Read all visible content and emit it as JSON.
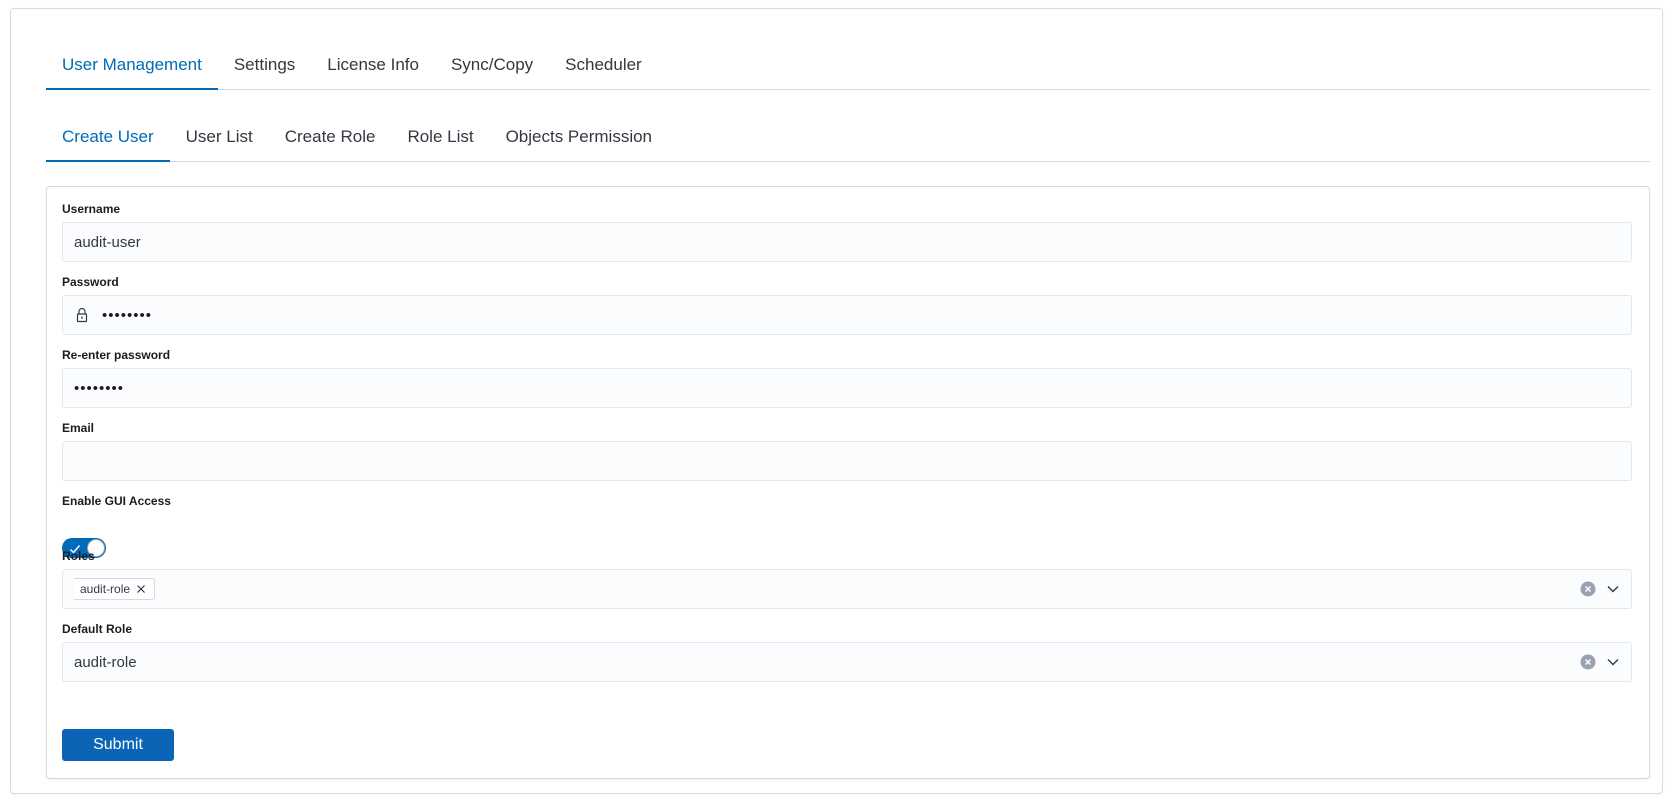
{
  "top_tabs": [
    {
      "label": "User Management",
      "active": true
    },
    {
      "label": "Settings",
      "active": false
    },
    {
      "label": "License Info",
      "active": false
    },
    {
      "label": "Sync/Copy",
      "active": false
    },
    {
      "label": "Scheduler",
      "active": false
    }
  ],
  "sub_tabs": [
    {
      "label": "Create User",
      "active": true
    },
    {
      "label": "User List",
      "active": false
    },
    {
      "label": "Create Role",
      "active": false
    },
    {
      "label": "Role List",
      "active": false
    },
    {
      "label": "Objects Permission",
      "active": false
    }
  ],
  "form": {
    "username": {
      "label": "Username",
      "value": "audit-user"
    },
    "password": {
      "label": "Password",
      "value": "••••••••"
    },
    "reenter_password": {
      "label": "Re-enter password",
      "value": "••••••••"
    },
    "email": {
      "label": "Email",
      "value": ""
    },
    "gui_access": {
      "label": "Enable GUI Access",
      "enabled": true
    },
    "roles": {
      "label": "Roles",
      "selected": [
        "audit-role"
      ]
    },
    "default_role": {
      "label": "Default Role",
      "value": "audit-role"
    },
    "submit_label": "Submit"
  },
  "colors": {
    "accent": "#006bb8",
    "button": "#0b64b5",
    "border": "#d3dae6",
    "field_bg": "#fbfcfd"
  },
  "icons": [
    "lock-icon",
    "check-icon",
    "close-icon",
    "clear-icon",
    "chevron-down-icon"
  ]
}
